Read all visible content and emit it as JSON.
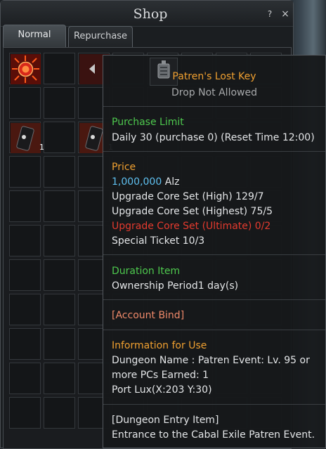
{
  "window": {
    "title": "Shop",
    "help_label": "?",
    "close_label": "×"
  },
  "tabs": [
    {
      "label": "Normal",
      "active": true
    },
    {
      "label": "Repurchase",
      "active": false
    }
  ],
  "grid_items": [
    {
      "icon": "red-orb-icon",
      "quantity": ""
    },
    {
      "icon": "gray-item-icon",
      "quantity": ""
    },
    {
      "icon": "dark-scroll-icon",
      "quantity": "1"
    },
    {
      "icon": "dark-scroll-icon",
      "quantity": "1"
    }
  ],
  "tooltip": {
    "item_icon": "key-icon",
    "item_name": "Patren's Lost Key",
    "drop_status": "Drop Not Allowed",
    "purchase_limit": {
      "heading": "Purchase Limit",
      "detail": "Daily 30 (purchase 0) (Reset Time 12:00)"
    },
    "price": {
      "heading": "Price",
      "alz_amount": "1,000,000",
      "alz_unit": " Alz",
      "costs": [
        {
          "text": "Upgrade Core Set (High) 129/7",
          "color": "#e4e6e8"
        },
        {
          "text": "Upgrade Core Set (Highest) 75/5",
          "color": "#e4e6e8"
        },
        {
          "text": "Upgrade Core Set (Ultimate) 0/2",
          "color": "#e43a2e"
        },
        {
          "text": "Special Ticket 10/3",
          "color": "#e4e6e8"
        }
      ]
    },
    "duration": {
      "heading": "Duration Item",
      "detail": "Ownership Period1 day(s)"
    },
    "bind": "[Account Bind]",
    "usage": {
      "heading": "Information for Use",
      "lines": [
        "Dungeon Name : Patren Event: Lv. 95 or",
        "more PCs Earned: 1",
        "Port Lux(X:203 Y:30)"
      ]
    },
    "entry": {
      "lines": [
        "[Dungeon Entry Item]",
        "Entrance to the Cabal Exile Patren Event."
      ]
    }
  }
}
